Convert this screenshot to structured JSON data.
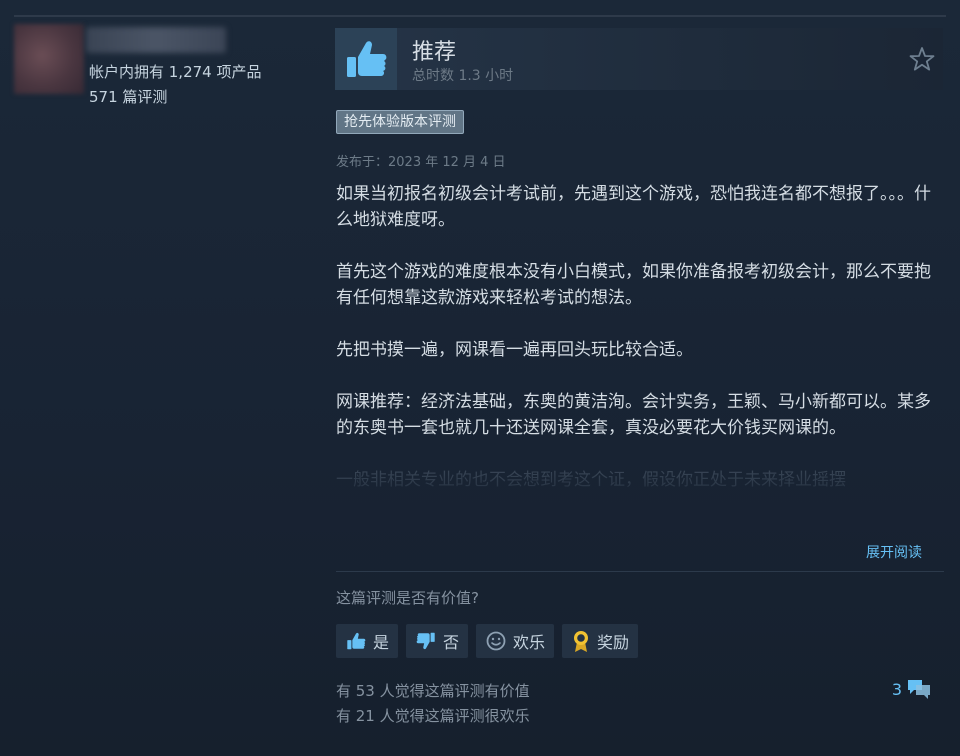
{
  "profile": {
    "products_owned": "帐户内拥有 1,274 项产品",
    "reviews_count": "571 篇评测"
  },
  "review": {
    "verdict": "推荐",
    "hours": "总时数 1.3 小时",
    "early_access_badge": "抢先体验版本评测",
    "posted_date": "发布于：2023 年 12 月 4 日",
    "paragraphs": [
      "如果当初报名初级会计考试前，先遇到这个游戏，恐怕我连名都不想报了。。。什么地狱难度呀。",
      "首先这个游戏的难度根本没有小白模式，如果你准备报考初级会计，那么不要抱有任何想靠这款游戏来轻松考试的想法。",
      "先把书摸一遍，网课看一遍再回头玩比较合适。",
      "网课推荐：经济法基础，东奥的黄洁洵。会计实务，王颖、马小新都可以。某多的东奥书一套也就几十还送网课全套，真没必要花大价钱买网课的。",
      "一般非相关专业的也不会想到考这个证，假设你正处于未来择业摇摆"
    ],
    "read_more": "展开阅读"
  },
  "feedback": {
    "question": "这篇评测是否有价值?",
    "yes_label": "是",
    "no_label": "否",
    "funny_label": "欢乐",
    "award_label": "奖励",
    "helpful_count_text": "有 53 人觉得这篇评测有价值",
    "funny_count_text": "有 21 人觉得这篇评测很欢乐",
    "comment_count": "3"
  },
  "icons": {
    "verdict": "thumbs-up-icon",
    "star": "star-icon",
    "yes": "thumbs-up-icon",
    "no": "thumbs-down-icon",
    "funny": "smiley-icon",
    "award": "award-ribbon-icon",
    "comments": "comment-bubbles-icon"
  },
  "colors": {
    "background": "#1b2838",
    "link": "#66c0f4",
    "badge": "#617586",
    "button": "#243243"
  }
}
